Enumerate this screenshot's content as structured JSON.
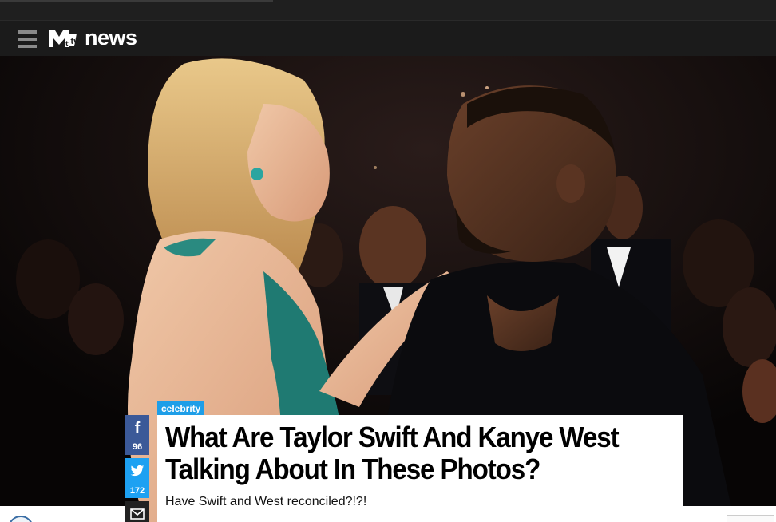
{
  "header": {
    "brand_text": "news",
    "logo": "mtv-logo",
    "menu_icon": "hamburger-menu-icon"
  },
  "hero": {
    "image": "photo of a blonde woman in a teal dress talking to a bearded man in a black suit at an event"
  },
  "article": {
    "category": "celebrity",
    "headline": "What Are Taylor Swift And Kanye West Talking About In These Photos?",
    "dek": "Have Swift and West reconciled?!?!"
  },
  "share": {
    "facebook": {
      "icon": "facebook-icon",
      "glyph": "f",
      "count": "96"
    },
    "twitter": {
      "icon": "twitter-icon",
      "glyph": "🐦",
      "count": "172"
    },
    "email": {
      "icon": "email-icon",
      "glyph": "✉"
    }
  },
  "colors": {
    "nav_bg": "#1b1b1b",
    "category_bg": "#1e9ee8",
    "facebook": "#3b5998",
    "twitter": "#1da1f2"
  }
}
